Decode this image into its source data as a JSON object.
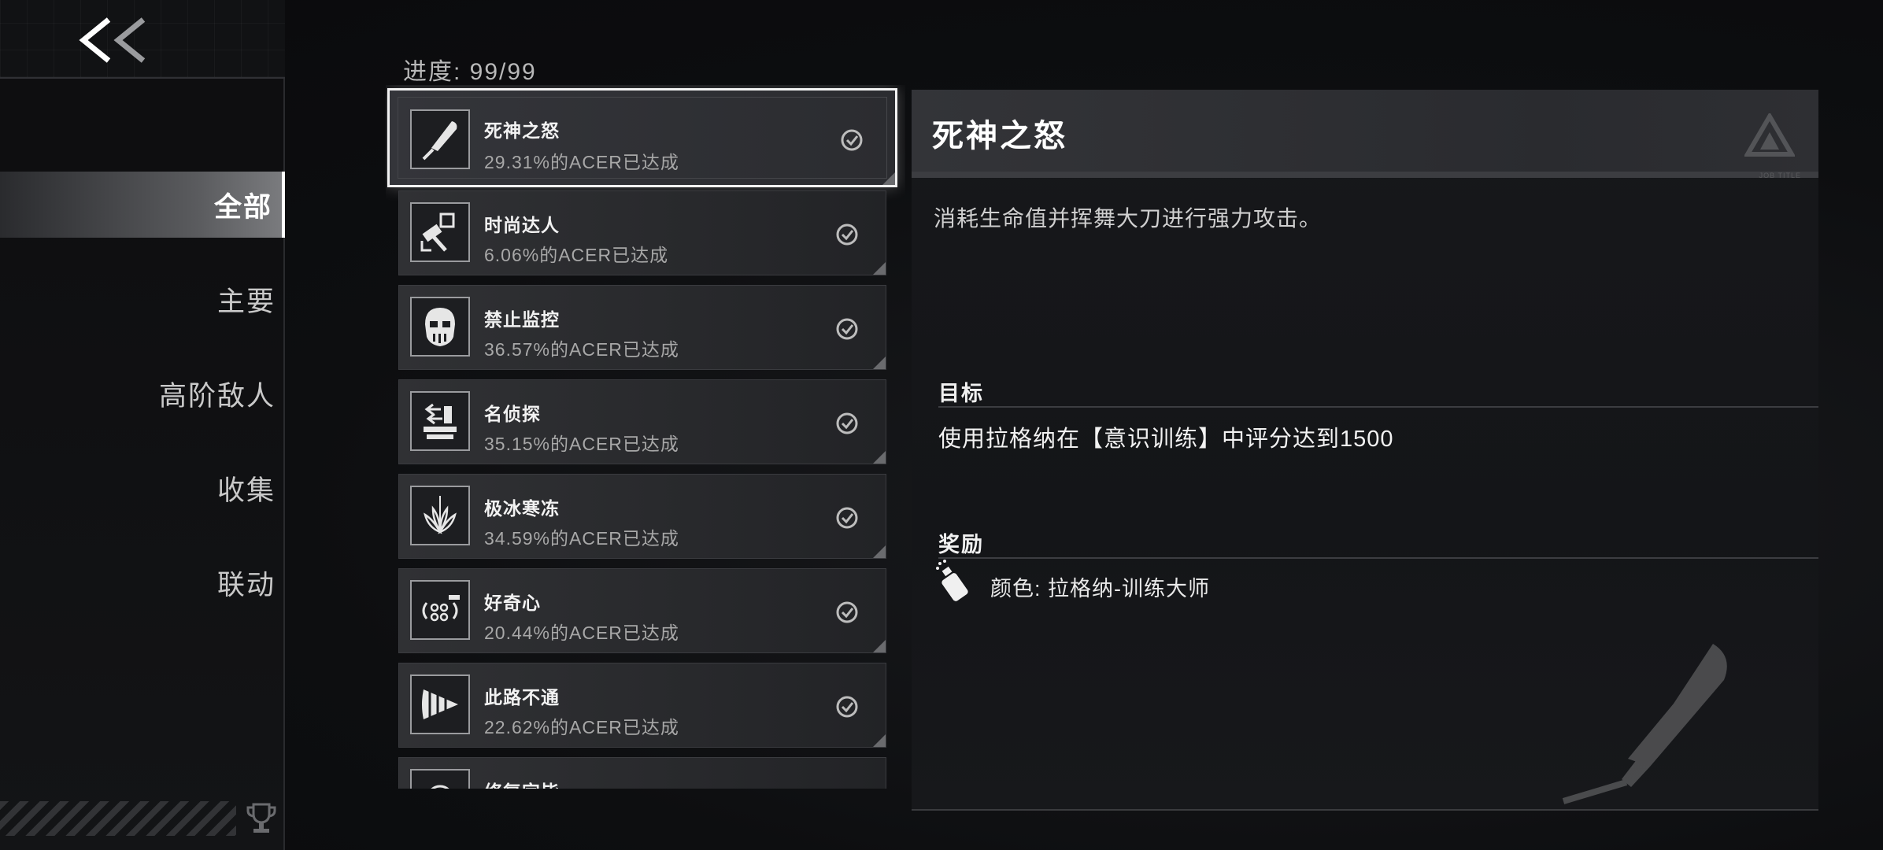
{
  "sidebar": {
    "nav": [
      {
        "label": "全部",
        "active": true
      },
      {
        "label": "主要",
        "active": false
      },
      {
        "label": "高阶敌人",
        "active": false
      },
      {
        "label": "收集",
        "active": false
      },
      {
        "label": "联动",
        "active": false
      }
    ]
  },
  "progress": {
    "label": "进度: 99/99"
  },
  "achievements": [
    {
      "title": "死神之怒",
      "stat": "29.31%的ACER已达成",
      "icon": "scythe-blade-icon",
      "completed": true
    },
    {
      "title": "时尚达人",
      "stat": "6.06%的ACER已达成",
      "icon": "fashion-hammer-icon",
      "completed": true
    },
    {
      "title": "禁止监控",
      "stat": "36.57%的ACER已达成",
      "icon": "masked-face-icon",
      "completed": true
    },
    {
      "title": "名侦探",
      "stat": "35.15%的ACER已达成",
      "icon": "detective-icon",
      "completed": true
    },
    {
      "title": "极冰寒冻",
      "stat": "34.59%的ACER已达成",
      "icon": "ice-crystal-icon",
      "completed": true
    },
    {
      "title": "好奇心",
      "stat": "20.44%的ACER已达成",
      "icon": "curiosity-icon",
      "completed": true
    },
    {
      "title": "此路不通",
      "stat": "22.62%的ACER已达成",
      "icon": "drill-icon",
      "completed": true
    },
    {
      "title": "修复完毕",
      "stat": "",
      "icon": "repair-icon",
      "completed": true
    }
  ],
  "detail": {
    "title": "死神之怒",
    "description": "消耗生命值并挥舞大刀进行强力攻击。",
    "objective_label": "目标",
    "objective": "使用拉格纳在【意识训练】中评分达到1500",
    "reward_label": "奖励",
    "reward": "颜色: 拉格纳-训练大师",
    "reward_icon": "paint-spray-icon",
    "header_tag": "JOB TITLE"
  },
  "colors": {
    "accent": "#ffffff",
    "panel": "#2c2d31",
    "background": "#0c0d0f"
  }
}
